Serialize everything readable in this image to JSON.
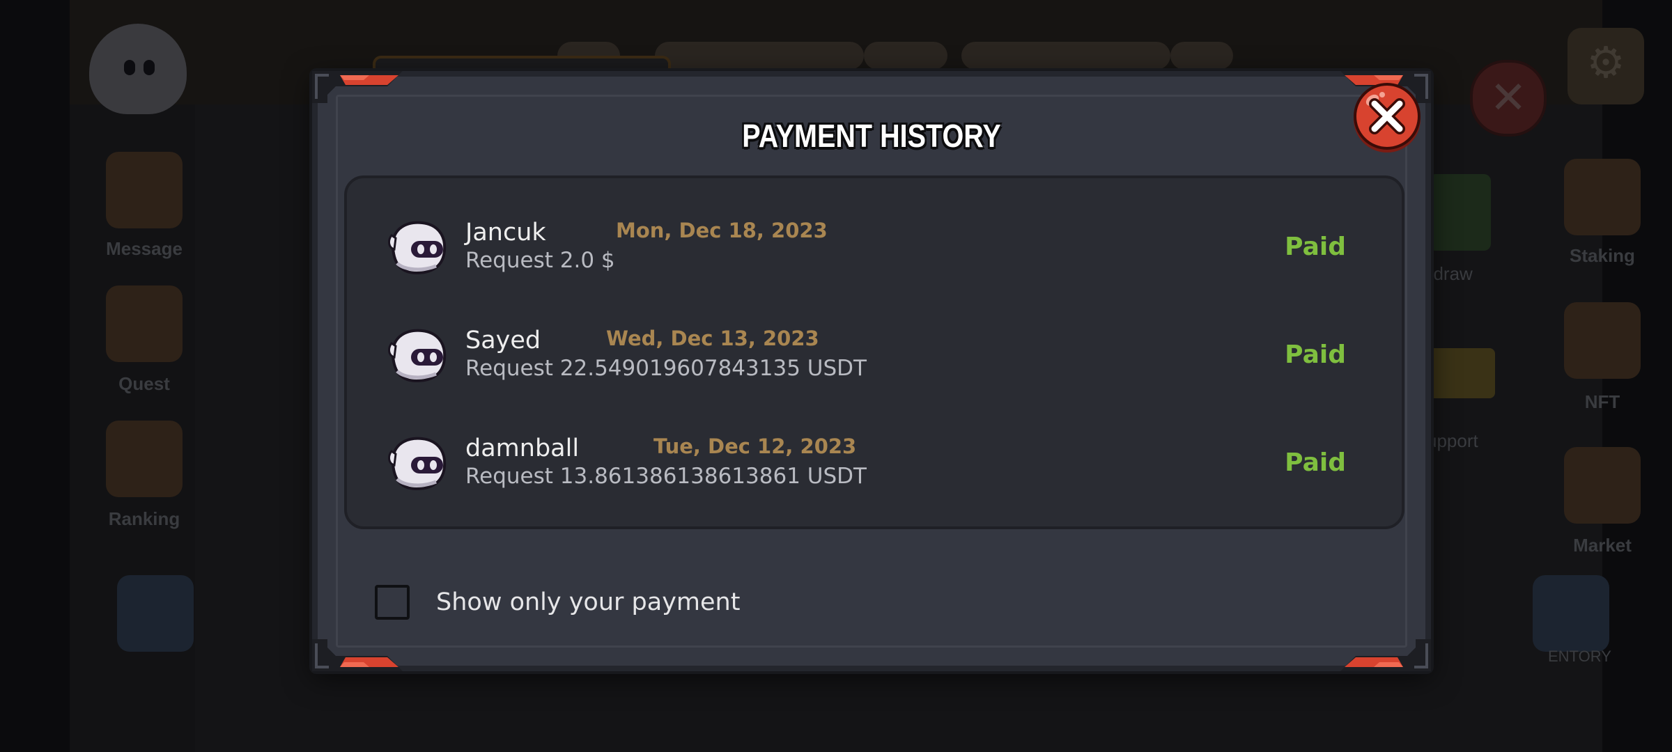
{
  "modal": {
    "title": "PAYMENT HISTORY",
    "close_icon": "close-x-icon"
  },
  "payments": [
    {
      "name": "Jancuk",
      "date": "Mon, Dec 18, 2023",
      "request": "Request 2.0 $",
      "status": "Paid"
    },
    {
      "name": "Sayed",
      "date": "Wed, Dec 13, 2023",
      "request": "Request 22.549019607843135 USDT",
      "status": "Paid"
    },
    {
      "name": "damnball",
      "date": "Tue, Dec 12, 2023",
      "request": "Request 13.861386138613861 USDT",
      "status": "Paid"
    }
  ],
  "filter": {
    "label": "Show only your payment",
    "checked": false
  },
  "background": {
    "menu_left": [
      "Message",
      "Quest",
      "Ranking"
    ],
    "menu_right": [
      "Staking",
      "NFT",
      "Market"
    ],
    "partial_labels": [
      "ithdraw",
      "upport",
      "ENTORY"
    ]
  },
  "colors": {
    "modal_bg": "#343741",
    "panel_bg": "#2a2c33",
    "date": "#a98651",
    "status_paid": "#7fbf3f",
    "accent_red": "#d8432f"
  }
}
